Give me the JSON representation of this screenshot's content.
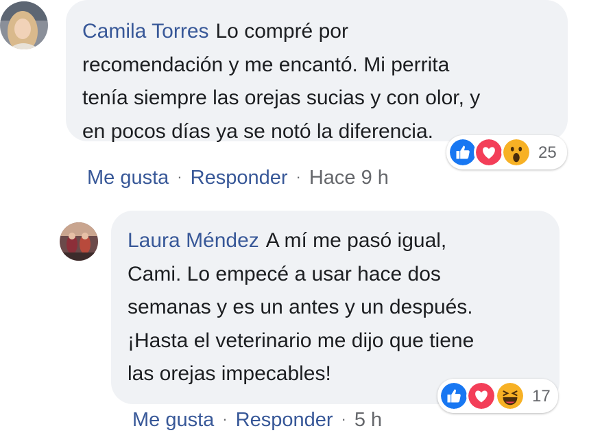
{
  "comments": [
    {
      "author": "Camila Torres",
      "lines": [
        "Lo compré por",
        "recomendación y me encantó. Mi perrita",
        "tenía siempre las orejas sucias y con olor, y",
        "en pocos días ya se notó la diferencia."
      ],
      "reactions": {
        "icons": [
          "like-icon",
          "love-icon",
          "wow-icon"
        ],
        "count": "25"
      },
      "actions": {
        "like": "Me gusta",
        "reply": "Responder",
        "separator": "·",
        "time": "Hace 9 h"
      }
    },
    {
      "author": "Laura Méndez",
      "lines": [
        "A mí me pasó igual,",
        "Cami. Lo empecé a usar hace dos",
        "semanas y es un antes y un después.",
        "¡Hasta el veterinario me dijo que tiene",
        "las orejas impecables!"
      ],
      "reactions": {
        "icons": [
          "like-icon",
          "love-icon",
          "haha-icon"
        ],
        "count": "17"
      },
      "actions": {
        "like": "Me gusta",
        "reply": "Responder",
        "separator": "·",
        "time": "5 h"
      }
    }
  ],
  "colors": {
    "author": "#385898",
    "text": "#1c1e21",
    "meta": "#65676b",
    "bubble": "#f0f2f5",
    "like": "#1877f2",
    "love": "#f33e58",
    "emoji": "#f7b125"
  }
}
